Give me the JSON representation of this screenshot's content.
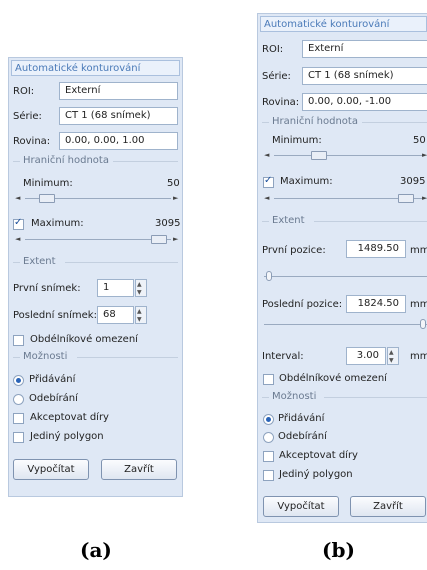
{
  "panel_a": {
    "title": "Automatické konturování",
    "roi_label": "ROI:",
    "roi_value": "Externí",
    "series_label": "Série:",
    "series_value": "CT 1 (68 snímek)",
    "plane_label": "Rovina:",
    "plane_value": "0.00, 0.00, 1.00",
    "threshold_group": "Hraniční hodnota",
    "minimum_label": "Minimum:",
    "minimum_value": "50",
    "maximum_label": "Maximum:",
    "maximum_value": "3095",
    "maximum_checked": true,
    "extent_group": "Extent",
    "first_slice_label": "První snímek:",
    "first_slice_value": "1",
    "last_slice_label": "Poslední snímek:",
    "last_slice_value": "68",
    "rect_limit_label": "Obdélníkové omezení",
    "rect_limit_checked": false,
    "options_group": "Možnosti",
    "add_label": "Přidávání",
    "add_selected": true,
    "subtract_label": "Odebírání",
    "accept_holes_label": "Akceptovat díry",
    "single_polygon_label": "Jediný polygon",
    "compute_button": "Vypočítat",
    "close_button": "Zavřít"
  },
  "panel_b": {
    "title": "Automatické konturování",
    "roi_label": "ROI:",
    "roi_value": "Externí",
    "series_label": "Série:",
    "series_value": "CT 1 (68 snímek)",
    "plane_label": "Rovina:",
    "plane_value": "0.00, 0.00, -1.00",
    "threshold_group": "Hraniční hodnota",
    "minimum_label": "Minimum:",
    "minimum_value": "50",
    "maximum_label": "Maximum:",
    "maximum_value": "3095",
    "maximum_checked": true,
    "extent_group": "Extent",
    "first_pos_label": "První pozice:",
    "first_pos_value": "1489.50",
    "first_pos_unit": "mm",
    "last_pos_label": "Poslední pozice:",
    "last_pos_value": "1824.50",
    "last_pos_unit": "mm",
    "interval_label": "Interval:",
    "interval_value": "3.00",
    "interval_unit": "mm",
    "rect_limit_label": "Obdélníkové omezení",
    "options_group": "Možnosti",
    "add_label": "Přidávání",
    "subtract_label": "Odebírání",
    "accept_holes_label": "Akceptovat díry",
    "single_polygon_label": "Jediný polygon",
    "compute_button": "Vypočítat",
    "close_button": "Zavřít"
  },
  "captions": {
    "a": "(a)",
    "b": "(b)"
  }
}
